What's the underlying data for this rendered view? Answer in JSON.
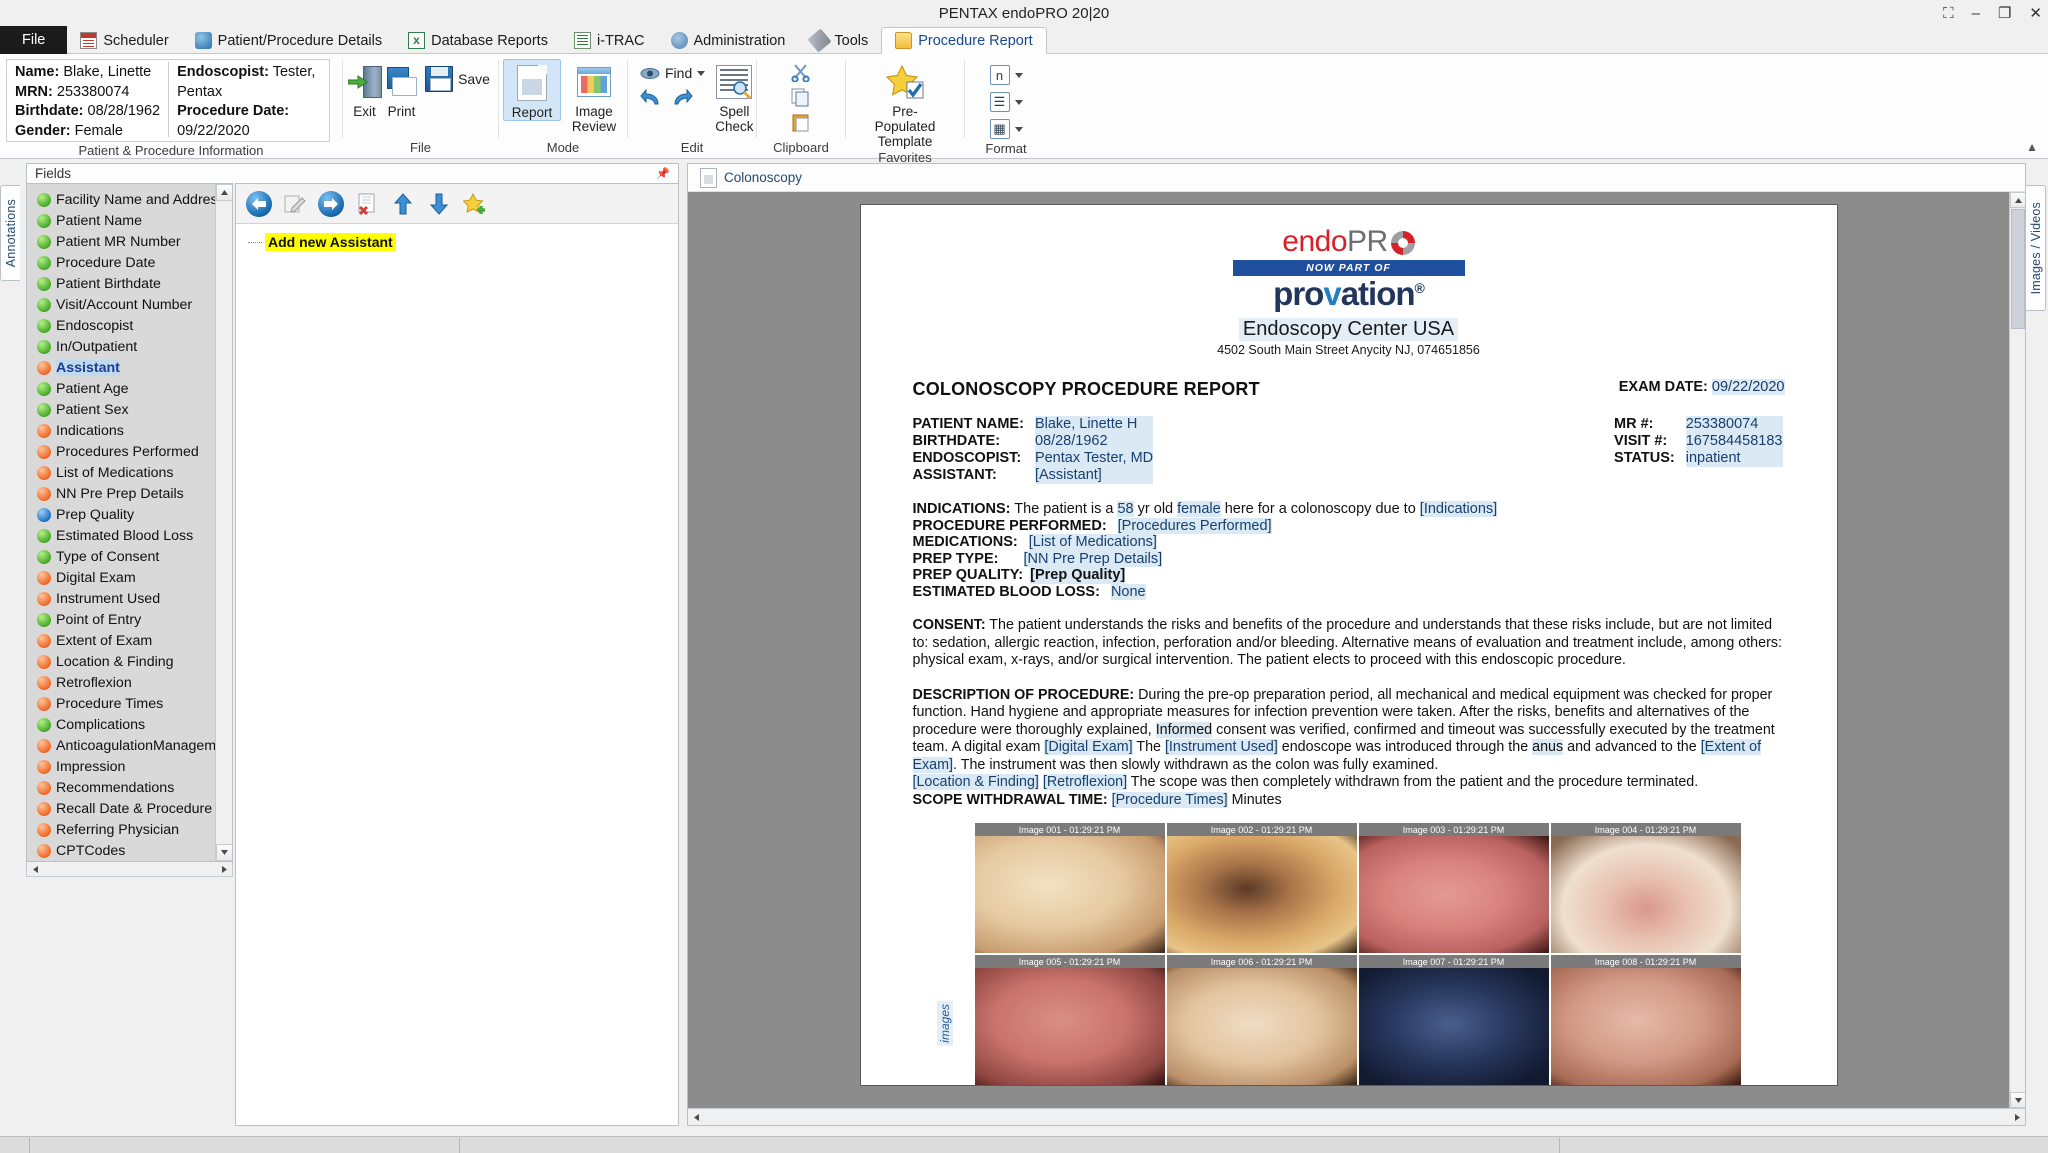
{
  "window": {
    "title": "PENTAX endoPRO 20|20",
    "buttons": [
      "restore-down",
      "minimize",
      "maximize",
      "close"
    ]
  },
  "menu": {
    "file_label": "File",
    "tabs": [
      {
        "label": "Scheduler",
        "icon": "calendar-icon",
        "active": false
      },
      {
        "label": "Patient/Procedure Details",
        "icon": "patient-icon",
        "active": false
      },
      {
        "label": "Database Reports",
        "icon": "excel-icon",
        "active": false
      },
      {
        "label": "i-TRAC",
        "icon": "itrac-icon",
        "active": false
      },
      {
        "label": "Administration",
        "icon": "gear-icon",
        "active": false
      },
      {
        "label": "Tools",
        "icon": "wrench-icon",
        "active": false
      },
      {
        "label": "Procedure Report",
        "icon": "folder-icon",
        "active": true
      }
    ]
  },
  "ribbon": {
    "patient": {
      "group_label": "Patient & Procedure Information",
      "left": [
        {
          "key": "Name:",
          "value": "Blake, Linette"
        },
        {
          "key": "MRN:",
          "value": "253380074"
        },
        {
          "key": "Birthdate:",
          "value": "08/28/1962"
        },
        {
          "key": "Gender:",
          "value": "Female"
        }
      ],
      "right": [
        {
          "key": "Endoscopist:",
          "value": "Tester, Pentax"
        },
        {
          "key": "Procedure Date:",
          "value": "09/22/2020"
        }
      ]
    },
    "file_group": {
      "label": "File",
      "exit": "Exit",
      "print": "Print",
      "save": "Save"
    },
    "mode_group": {
      "label": "Mode",
      "report": "Report",
      "image_review": "Image Review"
    },
    "edit_group": {
      "label": "Edit",
      "find": "Find",
      "spell_check": "Spell Check",
      "undo": "undo",
      "redo": "redo"
    },
    "clipboard_group": {
      "label": "Clipboard",
      "cut": "cut",
      "copy": "copy",
      "paste": "paste"
    },
    "favorites_group": {
      "label": "Favorites",
      "pre_populated_template": "Pre-Populated Template"
    },
    "format_group": {
      "label": "Format",
      "items": [
        "n",
        "paragraph",
        "table"
      ]
    }
  },
  "left_panel": {
    "vertical_tab": "Annotations",
    "fields_header": "Fields",
    "fields": [
      {
        "label": "Facility Name and Address",
        "status": "green"
      },
      {
        "label": "Patient Name",
        "status": "green"
      },
      {
        "label": "Patient MR Number",
        "status": "green"
      },
      {
        "label": "Procedure Date",
        "status": "green"
      },
      {
        "label": "Patient Birthdate",
        "status": "green"
      },
      {
        "label": "Visit/Account Number",
        "status": "green"
      },
      {
        "label": "Endoscopist",
        "status": "green"
      },
      {
        "label": "In/Outpatient",
        "status": "green"
      },
      {
        "label": "Assistant",
        "status": "orange",
        "selected": true
      },
      {
        "label": "Patient Age",
        "status": "green"
      },
      {
        "label": "Patient Sex",
        "status": "green"
      },
      {
        "label": "Indications",
        "status": "orange"
      },
      {
        "label": "Procedures Performed",
        "status": "orange"
      },
      {
        "label": "List of Medications",
        "status": "orange"
      },
      {
        "label": "NN Pre Prep Details",
        "status": "orange"
      },
      {
        "label": "Prep Quality",
        "status": "blue"
      },
      {
        "label": "Estimated Blood Loss",
        "status": "green"
      },
      {
        "label": "Type of Consent",
        "status": "green"
      },
      {
        "label": "Digital Exam",
        "status": "orange"
      },
      {
        "label": "Instrument Used",
        "status": "orange"
      },
      {
        "label": "Point of Entry",
        "status": "green"
      },
      {
        "label": "Extent of Exam",
        "status": "orange"
      },
      {
        "label": "Location & Finding",
        "status": "orange"
      },
      {
        "label": "Retroflexion",
        "status": "orange"
      },
      {
        "label": "Procedure Times",
        "status": "orange"
      },
      {
        "label": "Complications",
        "status": "green"
      },
      {
        "label": "AnticoagulationManagement",
        "status": "orange"
      },
      {
        "label": "Impression",
        "status": "orange"
      },
      {
        "label": "Recommendations",
        "status": "orange"
      },
      {
        "label": "Recall Date & Procedure",
        "status": "orange"
      },
      {
        "label": "Referring Physician",
        "status": "orange"
      },
      {
        "label": "CPTCodes",
        "status": "orange"
      }
    ],
    "tree_toolbar": [
      "back-icon",
      "edit-icon",
      "forward-icon",
      "delete-icon",
      "move-up-icon",
      "move-down-icon",
      "add-favorite-icon"
    ],
    "tree_node": "Add new Assistant"
  },
  "right_panel": {
    "vertical_tab": "Images / Videos"
  },
  "document": {
    "tab_label": "Colonoscopy",
    "logo": {
      "endo_red": "endo",
      "endo_gray": "PR",
      "now_part_of": "NOW PART OF",
      "provation_1": "pro",
      "provation_v": "v",
      "provation_2": "ation"
    },
    "facility_name": "Endoscopy Center USA",
    "facility_address": "4502 South Main Street Anycity NJ, 074651856",
    "report_title": "COLONOSCOPY PROCEDURE REPORT",
    "exam_date_label": "EXAM DATE:",
    "exam_date_value": "09/22/2020",
    "demographics_left": [
      {
        "key": "PATIENT NAME:",
        "value": "Blake, Linette H"
      },
      {
        "key": "BIRTHDATE:",
        "value": "08/28/1962"
      },
      {
        "key": "ENDOSCOPIST:",
        "value": "Pentax Tester, MD"
      },
      {
        "key": "ASSISTANT:",
        "value": "[Assistant]"
      }
    ],
    "demographics_right": [
      {
        "key": "MR #:",
        "value": "253380074"
      },
      {
        "key": "VISIT #:",
        "value": "167584458183"
      },
      {
        "key": "STATUS:",
        "value": "inpatient"
      }
    ],
    "indications_label": "INDICATIONS:",
    "indications_pre": "The patient is a",
    "indications_age": "58",
    "indications_mid": "yr old",
    "indications_sex": "female",
    "indications_post": "here for a colonoscopy due to",
    "indications_token": "[Indications]",
    "procedure_performed_label": "PROCEDURE PERFORMED:",
    "procedure_performed_value": "[Procedures Performed]",
    "medications_label": "MEDICATIONS:",
    "medications_value": "[List of Medications]",
    "prep_type_label": "PREP TYPE:",
    "prep_type_value": "[NN Pre Prep Details]",
    "prep_quality_label": "PREP QUALITY:",
    "prep_quality_value": "[Prep Quality]",
    "ebl_label": "ESTIMATED BLOOD LOSS:",
    "ebl_value": "None",
    "consent_label": "CONSENT:",
    "consent_text": " The patient understands the risks and benefits of the procedure and understands that these risks include, but are not limited to: sedation, allergic reaction, infection, perforation and/or bleeding. Alternative means of evaluation and treatment include, among others: physical exam, x-rays, and/or surgical intervention. The patient elects to proceed with this endoscopic procedure.",
    "description_label": "DESCRIPTION OF PROCEDURE:",
    "description_p1": " During the pre-op preparation period, all mechanical and medical equipment was checked for proper function. Hand hygiene and appropriate measures for infection prevention were taken. After the risks, benefits and alternatives of the procedure were thoroughly explained, ",
    "description_informed": "Informed",
    "description_p2": " consent was verified, confirmed and timeout was successfully executed by the treatment team. A digital exam ",
    "description_tok_digital": "[Digital Exam]",
    "description_p3": " The ",
    "description_tok_instrument": "[Instrument Used]",
    "description_p4": " endoscope was introduced through the ",
    "description_anus": "anus",
    "description_p5": " and advanced to the ",
    "description_tok_extent": "[Extent of Exam]",
    "description_p6": ". The instrument was then slowly withdrawn as the colon was fully examined.",
    "description_tok_location": "[Location & Finding]",
    "description_tok_retro": "[Retroflexion]",
    "description_p7": " The scope was then completely withdrawn from the patient and the procedure terminated.",
    "withdrawal_label": "SCOPE WITHDRAWAL TIME:",
    "withdrawal_token": "[Procedure Times]",
    "withdrawal_unit": "Minutes",
    "images_side_label": "images",
    "thumbnails": [
      {
        "caption": "Image 001 - 01:29:21 PM"
      },
      {
        "caption": "Image 002 - 01:29:21 PM"
      },
      {
        "caption": "Image 003 - 01:29:21 PM"
      },
      {
        "caption": "Image 004 - 01:29:21 PM"
      },
      {
        "caption": "Image 005 - 01:29:21 PM"
      },
      {
        "caption": "Image 006 - 01:29:21 PM"
      },
      {
        "caption": "Image 007 - 01:29:21 PM"
      },
      {
        "caption": "Image 008 - 01:29:21 PM"
      }
    ]
  },
  "colors": {
    "accent": "#1f4e9c",
    "endo_red": "#d62128",
    "highlight": "#ffff00",
    "token_bg": "#dbe9f4",
    "status_green": "#49ab2a",
    "status_orange": "#ef6a29",
    "status_blue": "#1d72c2"
  }
}
